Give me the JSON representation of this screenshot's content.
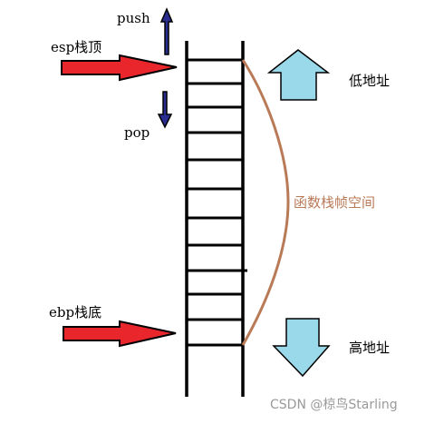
{
  "labels": {
    "push": "push",
    "pop": "pop",
    "esp": "esp栈顶",
    "ebp": "ebp栈底",
    "low_address": "低地址",
    "high_address": "高地址",
    "stack_frame": "函数栈帧空间"
  },
  "watermark": "CSDN @椋鸟Starling",
  "colors": {
    "stack_line": "#000000",
    "pointer_arrow_fill": "#e8262c",
    "direction_arrow_fill": "#2a2c8f",
    "address_arrow_fill": "#99d9ea",
    "frame_brace": "#b97a57",
    "frame_text": "#b97a57"
  },
  "icons": {
    "push_arrow": "arrow-up-icon",
    "pop_arrow": "arrow-down-icon",
    "pointer_arrow": "arrow-right-icon",
    "low_address_arrow": "block-arrow-up-icon",
    "high_address_arrow": "block-arrow-down-icon"
  }
}
